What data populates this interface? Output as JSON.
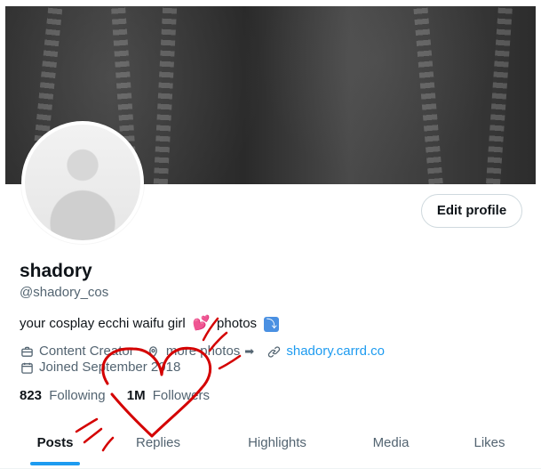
{
  "profile": {
    "display_name": "shadory",
    "handle": "@shadory_cos",
    "bio": {
      "text_before": "your cosplay ecchi waifu girl",
      "emoji": "💕",
      "text_after": "photos",
      "arrow_glyph": "⤵"
    },
    "meta": {
      "occupation": "Content Creator",
      "location": "more photos",
      "location_arrow": "➡",
      "website": "shadory.carrd.co",
      "joined": "Joined September 2018"
    },
    "following": {
      "count": "823",
      "label": "Following"
    },
    "followers": {
      "count": "1M",
      "label": "Followers"
    },
    "edit_button_label": "Edit profile"
  },
  "tabs": [
    {
      "label": "Posts",
      "active": true
    },
    {
      "label": "Replies",
      "active": false
    },
    {
      "label": "Highlights",
      "active": false
    },
    {
      "label": "Media",
      "active": false
    },
    {
      "label": "Likes",
      "active": false
    }
  ],
  "icons": {
    "briefcase": "briefcase-icon",
    "location": "location-pin-icon",
    "link": "link-icon",
    "calendar": "calendar-icon"
  },
  "colors": {
    "accent": "#1d9bf0",
    "annotation": "#d40000"
  }
}
